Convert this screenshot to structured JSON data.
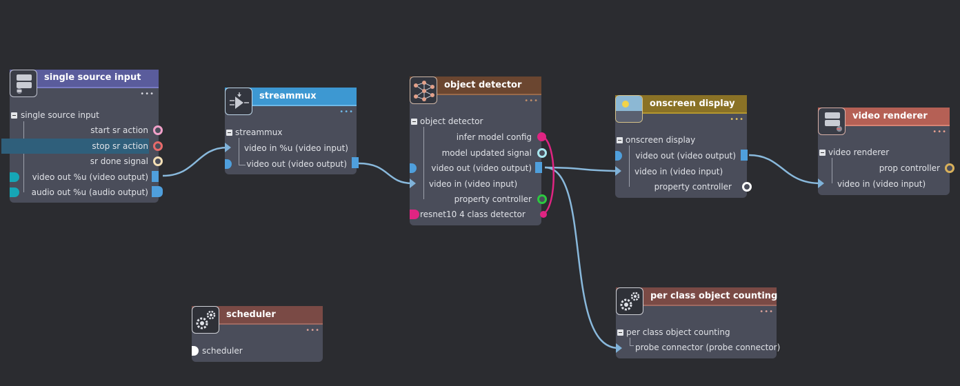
{
  "colors": {
    "canvas": "#2b2c30",
    "node_body": "#4a4d5a",
    "wire": "#89b9dc",
    "accent_blue": "#4f9fdc",
    "magenta": "#e02482",
    "teal": "#16a6b6",
    "green": "#2cc840",
    "gold": "#d8b05a"
  },
  "nodes": {
    "single_source_input": {
      "title": "single source input",
      "header_color": "#5a5c9c",
      "icon": "server-stack-icon",
      "group_label": "single source input",
      "rows": [
        "start sr action",
        "stop sr action",
        "sr done signal",
        "video out %u (video output)",
        "audio out %u (audio output)"
      ],
      "selected_row": "stop sr action"
    },
    "streammux": {
      "title": "streammux",
      "header_color": "#3d98d2",
      "icon": "mux-icon",
      "group_label": "streammux",
      "rows": [
        "video in %u (video input)",
        "video out (video output)"
      ]
    },
    "object_detector": {
      "title": "object detector",
      "header_color": "#6b4630",
      "icon": "neural-network-icon",
      "group_label": "object detector",
      "rows": [
        "infer model config",
        "model updated signal",
        "video out (video output)",
        "video in (video input)",
        "property controller"
      ],
      "extra_row": "resnet10 4 class detector"
    },
    "onscreen_display": {
      "title": "onscreen display",
      "header_color": "#8a7226",
      "icon": "display-icon",
      "group_label": "onscreen display",
      "rows": [
        "video out (video output)",
        "video in (video input)",
        "property controller"
      ]
    },
    "video_renderer": {
      "title": "video renderer",
      "header_color": "#b56055",
      "icon": "server-stack-icon",
      "group_label": "video renderer",
      "rows": [
        "prop controller",
        "video in (video input)"
      ]
    },
    "per_class_object_counting": {
      "title": "per class object counting",
      "header_color": "#7a4a45",
      "icon": "gears-icon",
      "group_label": "per class object counting",
      "rows": [
        "probe connector (probe connector)"
      ]
    },
    "scheduler": {
      "title": "scheduler",
      "header_color": "#7a4a45",
      "icon": "gears-icon",
      "rows": [
        "scheduler"
      ]
    }
  }
}
